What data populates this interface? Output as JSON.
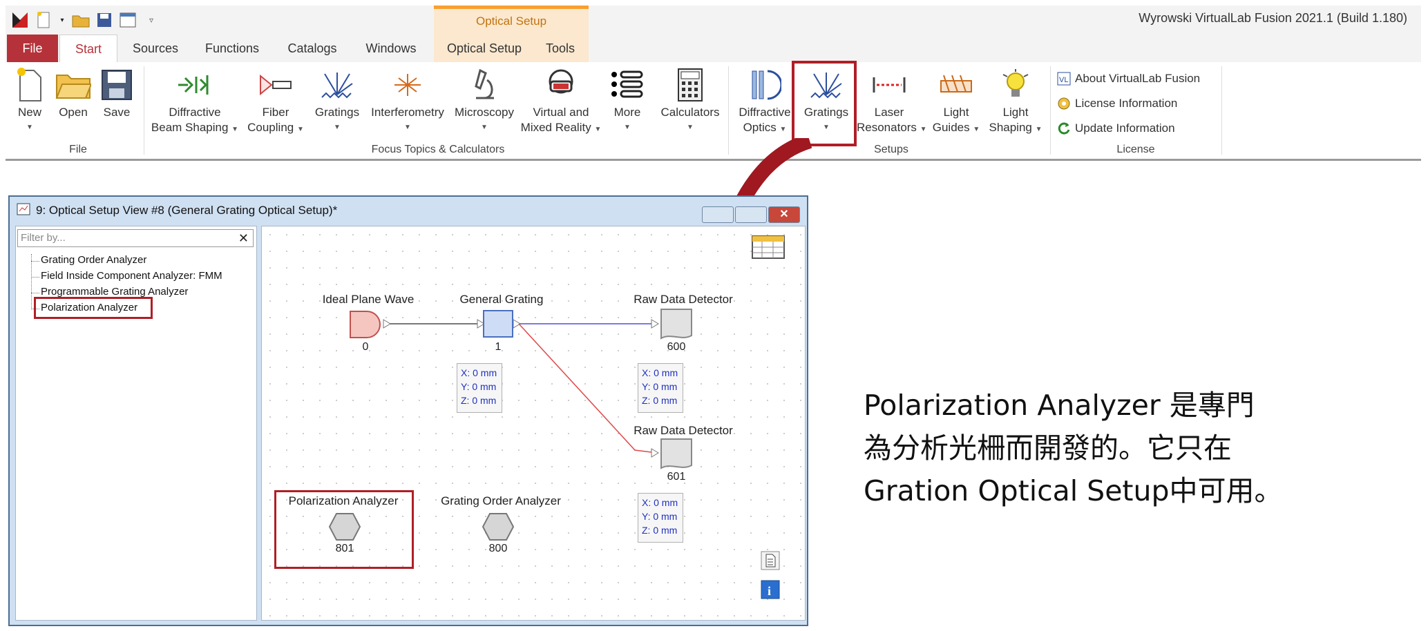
{
  "app": {
    "title": "Wyrowski VirtualLab Fusion 2021.1 (Build 1.180)",
    "context_tab_header": "Optical Setup"
  },
  "tabs": [
    {
      "label": "File"
    },
    {
      "label": "Start"
    },
    {
      "label": "Sources"
    },
    {
      "label": "Functions"
    },
    {
      "label": "Catalogs"
    },
    {
      "label": "Windows"
    },
    {
      "label": "Optical Setup"
    },
    {
      "label": "Tools"
    }
  ],
  "ribbon": {
    "file_group": {
      "label": "File",
      "new": "New",
      "open": "Open",
      "save": "Save"
    },
    "focus_group": {
      "label": "Focus Topics & Calculators",
      "diffractive_beam_1": "Diffractive",
      "diffractive_beam_2": "Beam Shaping",
      "fiber_1": "Fiber",
      "fiber_2": "Coupling",
      "gratings": "Gratings",
      "interferometry": "Interferometry",
      "microscopy": "Microscopy",
      "vr_1": "Virtual and",
      "vr_2": "Mixed Reality",
      "more": "More",
      "calculators": "Calculators"
    },
    "setups_group": {
      "label": "Setups",
      "diffractive_optics_1": "Diffractive",
      "diffractive_optics_2": "Optics",
      "gratings": "Gratings",
      "laser_1": "Laser",
      "laser_2": "Resonators",
      "light_guides_1": "Light",
      "light_guides_2": "Guides",
      "light_shaping_1": "Light",
      "light_shaping_2": "Shaping"
    },
    "license_group": {
      "label": "License",
      "about": "About VirtualLab Fusion",
      "license_info": "License Information",
      "update_info": "Update Information"
    }
  },
  "setup_window": {
    "title": "9: Optical Setup View #8 (General Grating Optical Setup)*",
    "filter_placeholder": "Filter by...",
    "close_glyph": "✕",
    "tree": [
      "Grating Order Analyzer",
      "Field Inside Component Analyzer: FMM",
      "Programmable Grating Analyzer",
      "Polarization Analyzer"
    ],
    "nodes": {
      "source": {
        "label": "Ideal Plane Wave",
        "id": "0"
      },
      "grating": {
        "label": "General Grating",
        "id": "1"
      },
      "det1": {
        "label": "Raw Data Detector",
        "id": "600"
      },
      "det2": {
        "label": "Raw Data Detector",
        "id": "601"
      },
      "pol": {
        "label": "Polarization Analyzer",
        "id": "801"
      },
      "goa": {
        "label": "Grating Order Analyzer",
        "id": "800"
      }
    },
    "position": {
      "x": "X: 0 mm",
      "y": "Y: 0 mm",
      "z": "Z: 0 mm"
    }
  },
  "note": {
    "line1": "Polarization  Analyzer 是專門",
    "line2": "為分析光柵而開發的。它只在",
    "line3": "Gration Optical Setup中可用。"
  },
  "colors": {
    "file_tab": "#b5323a",
    "highlight": "#b01e26",
    "context_accent": "#f7a030",
    "blue_link": "#2030c0"
  }
}
